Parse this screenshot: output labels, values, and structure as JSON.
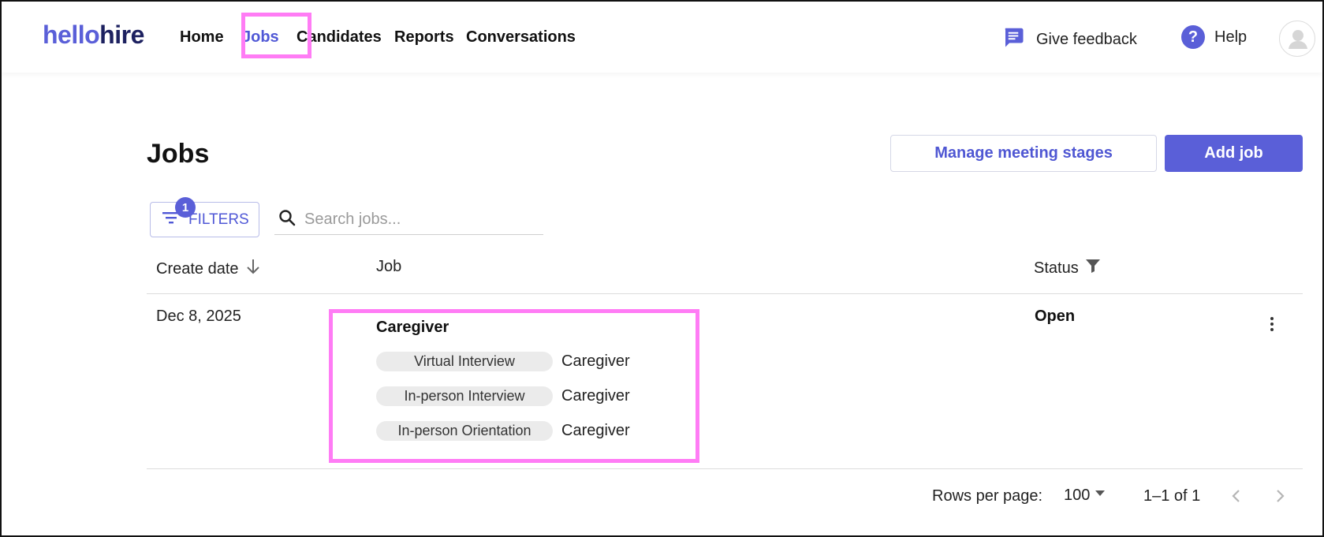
{
  "app": {
    "logo_part1": "hello",
    "logo_part2": "hire"
  },
  "nav": {
    "items": [
      {
        "label": "Home"
      },
      {
        "label": "Jobs"
      },
      {
        "label": "Candidates"
      },
      {
        "label": "Reports"
      },
      {
        "label": "Conversations"
      }
    ],
    "active": "Jobs",
    "feedback_label": "Give feedback",
    "help_label": "Help",
    "icons": {
      "feedback": "chat-icon",
      "help": "question-icon",
      "avatar": "user-avatar-icon"
    }
  },
  "page": {
    "title": "Jobs",
    "manage_button": "Manage meeting stages",
    "add_button": "Add job"
  },
  "toolbar": {
    "filters_label": "FILTERS",
    "filters_count": "1",
    "search_placeholder": "Search jobs..."
  },
  "table": {
    "headers": {
      "create_date": "Create date",
      "job": "Job",
      "status": "Status"
    },
    "rows": [
      {
        "create_date": "Dec 8, 2025",
        "job_name": "Caregiver",
        "stages": [
          {
            "stage": "Virtual Interview",
            "role": "Caregiver"
          },
          {
            "stage": "In-person Interview",
            "role": "Caregiver"
          },
          {
            "stage": "In-person Orientation",
            "role": "Caregiver"
          }
        ],
        "status": "Open"
      }
    ]
  },
  "pagination": {
    "rows_per_page_label": "Rows per page:",
    "rows_per_page": "100",
    "range": "1–1 of 1"
  },
  "colors": {
    "accent": "#5a5fd8",
    "highlight": "#ff7cf5"
  }
}
